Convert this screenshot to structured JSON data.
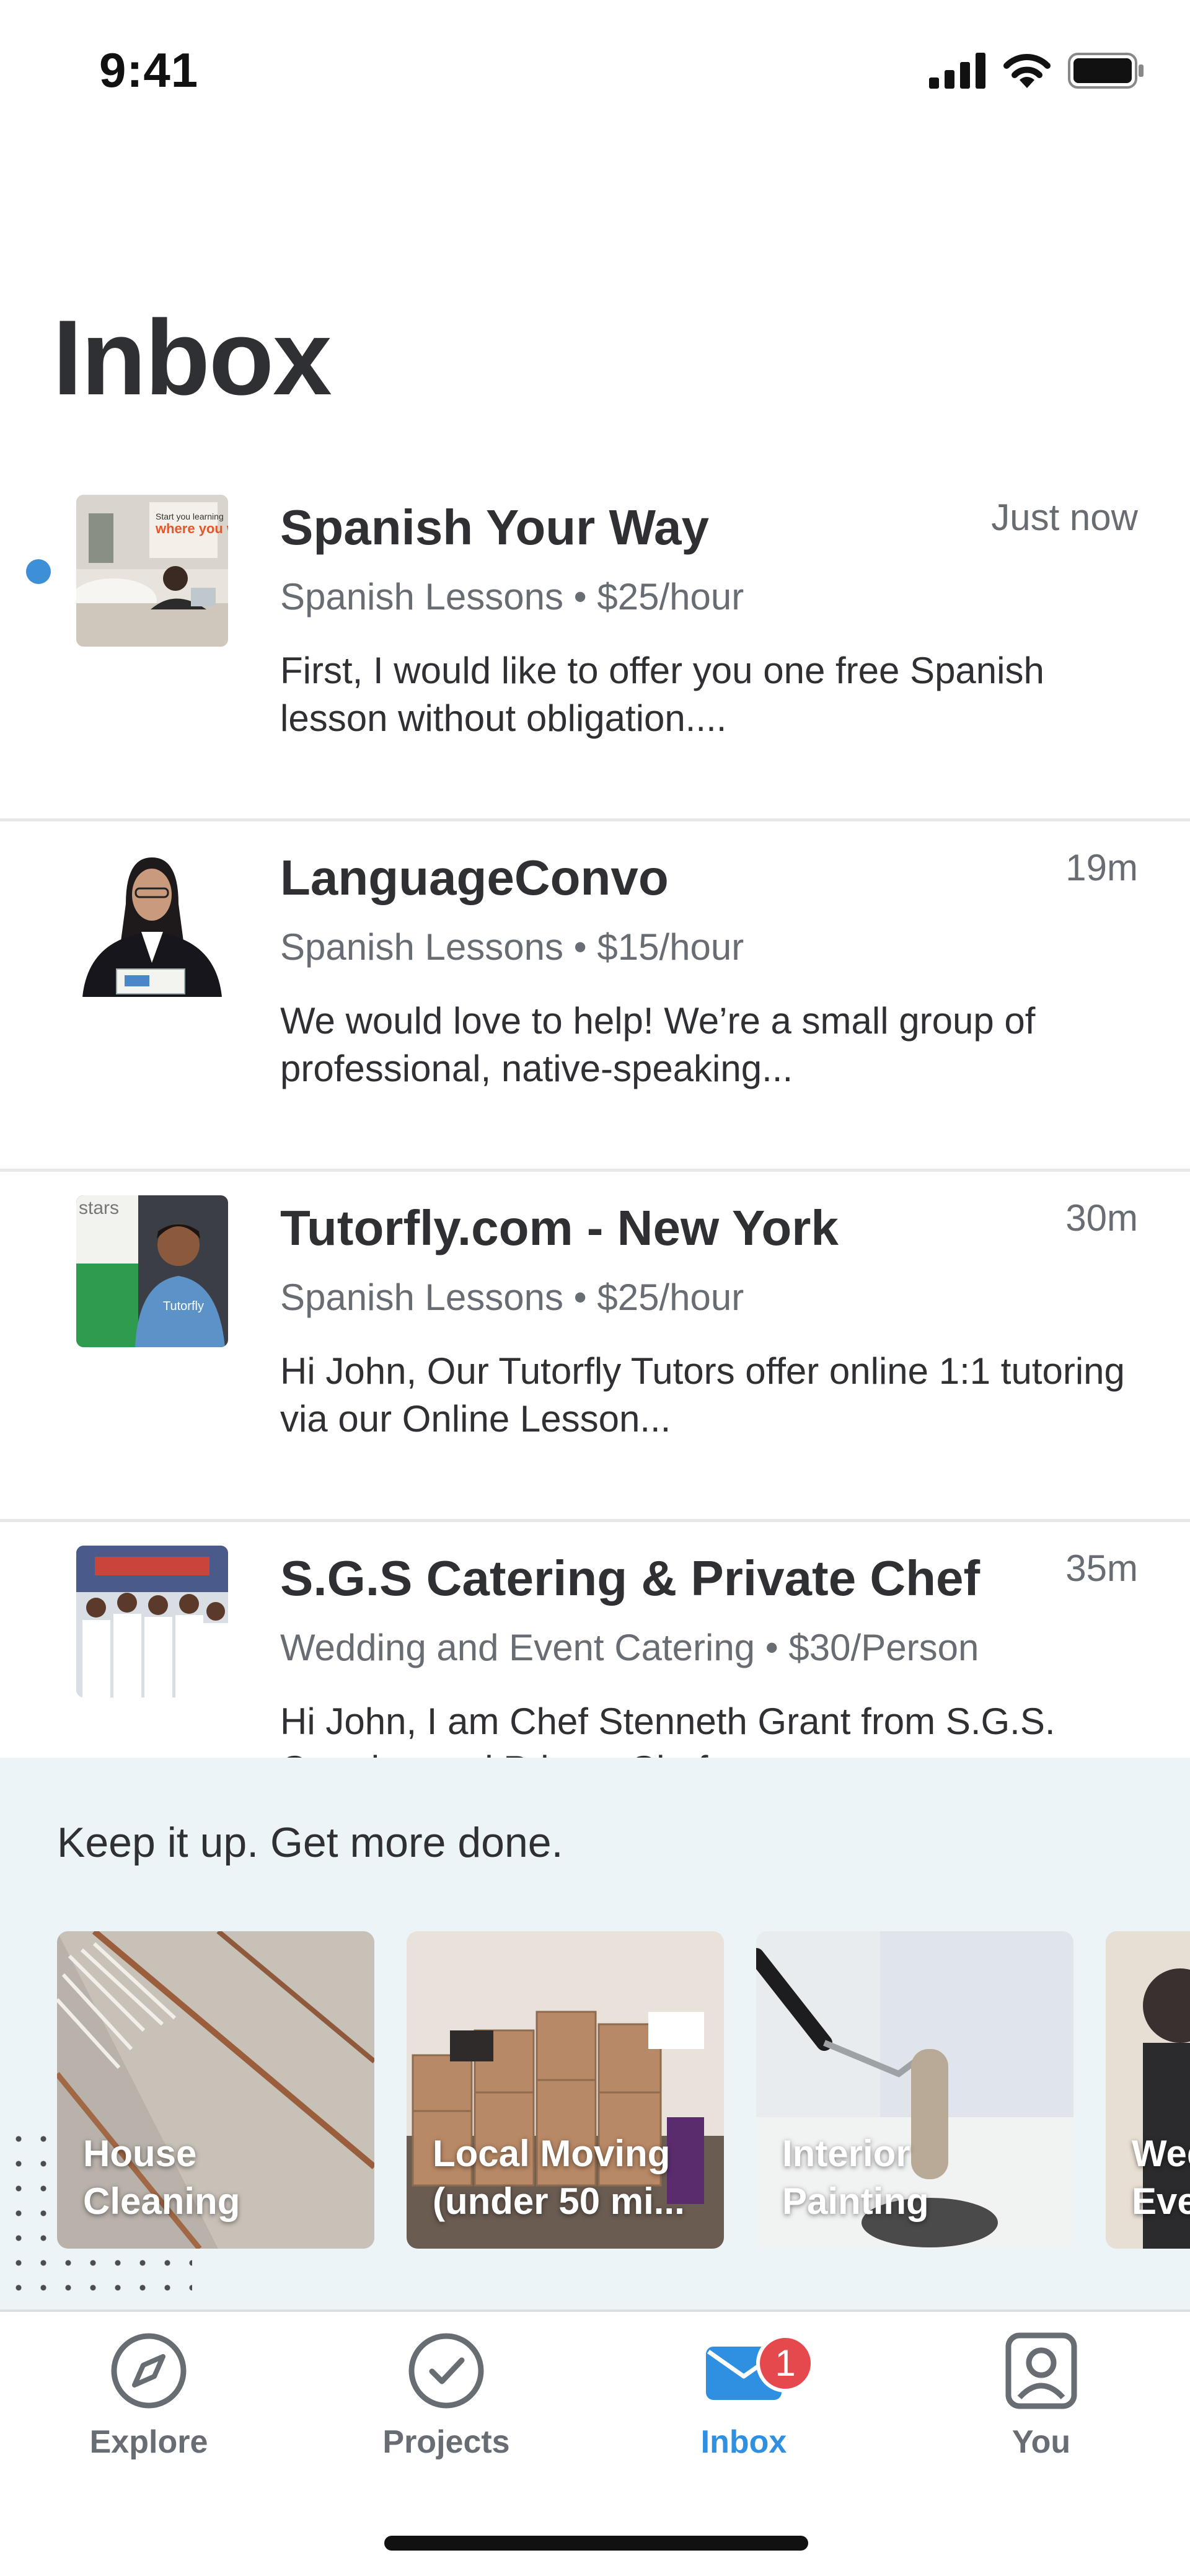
{
  "status_bar": {
    "time": "9:41"
  },
  "page": {
    "title": "Inbox"
  },
  "messages": [
    {
      "name": "Spanish Your Way",
      "time": "Just now",
      "service": "Spanish Lessons",
      "price": "$25/hour",
      "preview": "First, I would like to offer you one free Spanish lesson without obligation....",
      "unread": true,
      "thumb_text": "where you want"
    },
    {
      "name": "LanguageConvo",
      "time": "19m",
      "service": "Spanish Lessons",
      "price": "$15/hour",
      "preview": "We would love to help! We’re a small group of professional, native-speaking...",
      "unread": false
    },
    {
      "name": "Tutorfly.com - New York",
      "time": "30m",
      "service": "Spanish Lessons",
      "price": "$25/hour",
      "preview": "Hi John, Our Tutorfly Tutors offer online 1:1 tutoring via our Online Lesson...",
      "unread": false,
      "thumb_text": "stars"
    },
    {
      "name": "S.G.S Catering & Private Chef",
      "time": "35m",
      "service": "Wedding and Event Catering",
      "price": "$30/Person",
      "preview": "Hi John, I am Chef Stenneth Grant from S.G.S. Catering and Private Chef...",
      "unread": false
    }
  ],
  "meta_separator": "•",
  "promo": {
    "heading": "Keep it up. Get more done.",
    "cards": [
      {
        "label": "House Cleaning"
      },
      {
        "label": "Local Moving (under 50 mi..."
      },
      {
        "label": "Interior Painting"
      },
      {
        "label": "Wedding and Event"
      }
    ]
  },
  "tabs": [
    {
      "label": "Explore",
      "icon": "compass-icon"
    },
    {
      "label": "Projects",
      "icon": "check-circle-icon"
    },
    {
      "label": "Inbox",
      "icon": "mail-icon",
      "badge": "1",
      "active": true
    },
    {
      "label": "You",
      "icon": "profile-icon"
    }
  ],
  "colors": {
    "accent": "#2f8fe0",
    "unread_dot": "#3d8fd6",
    "badge": "#e5484d",
    "promo_bg": "#ecf4f8"
  }
}
